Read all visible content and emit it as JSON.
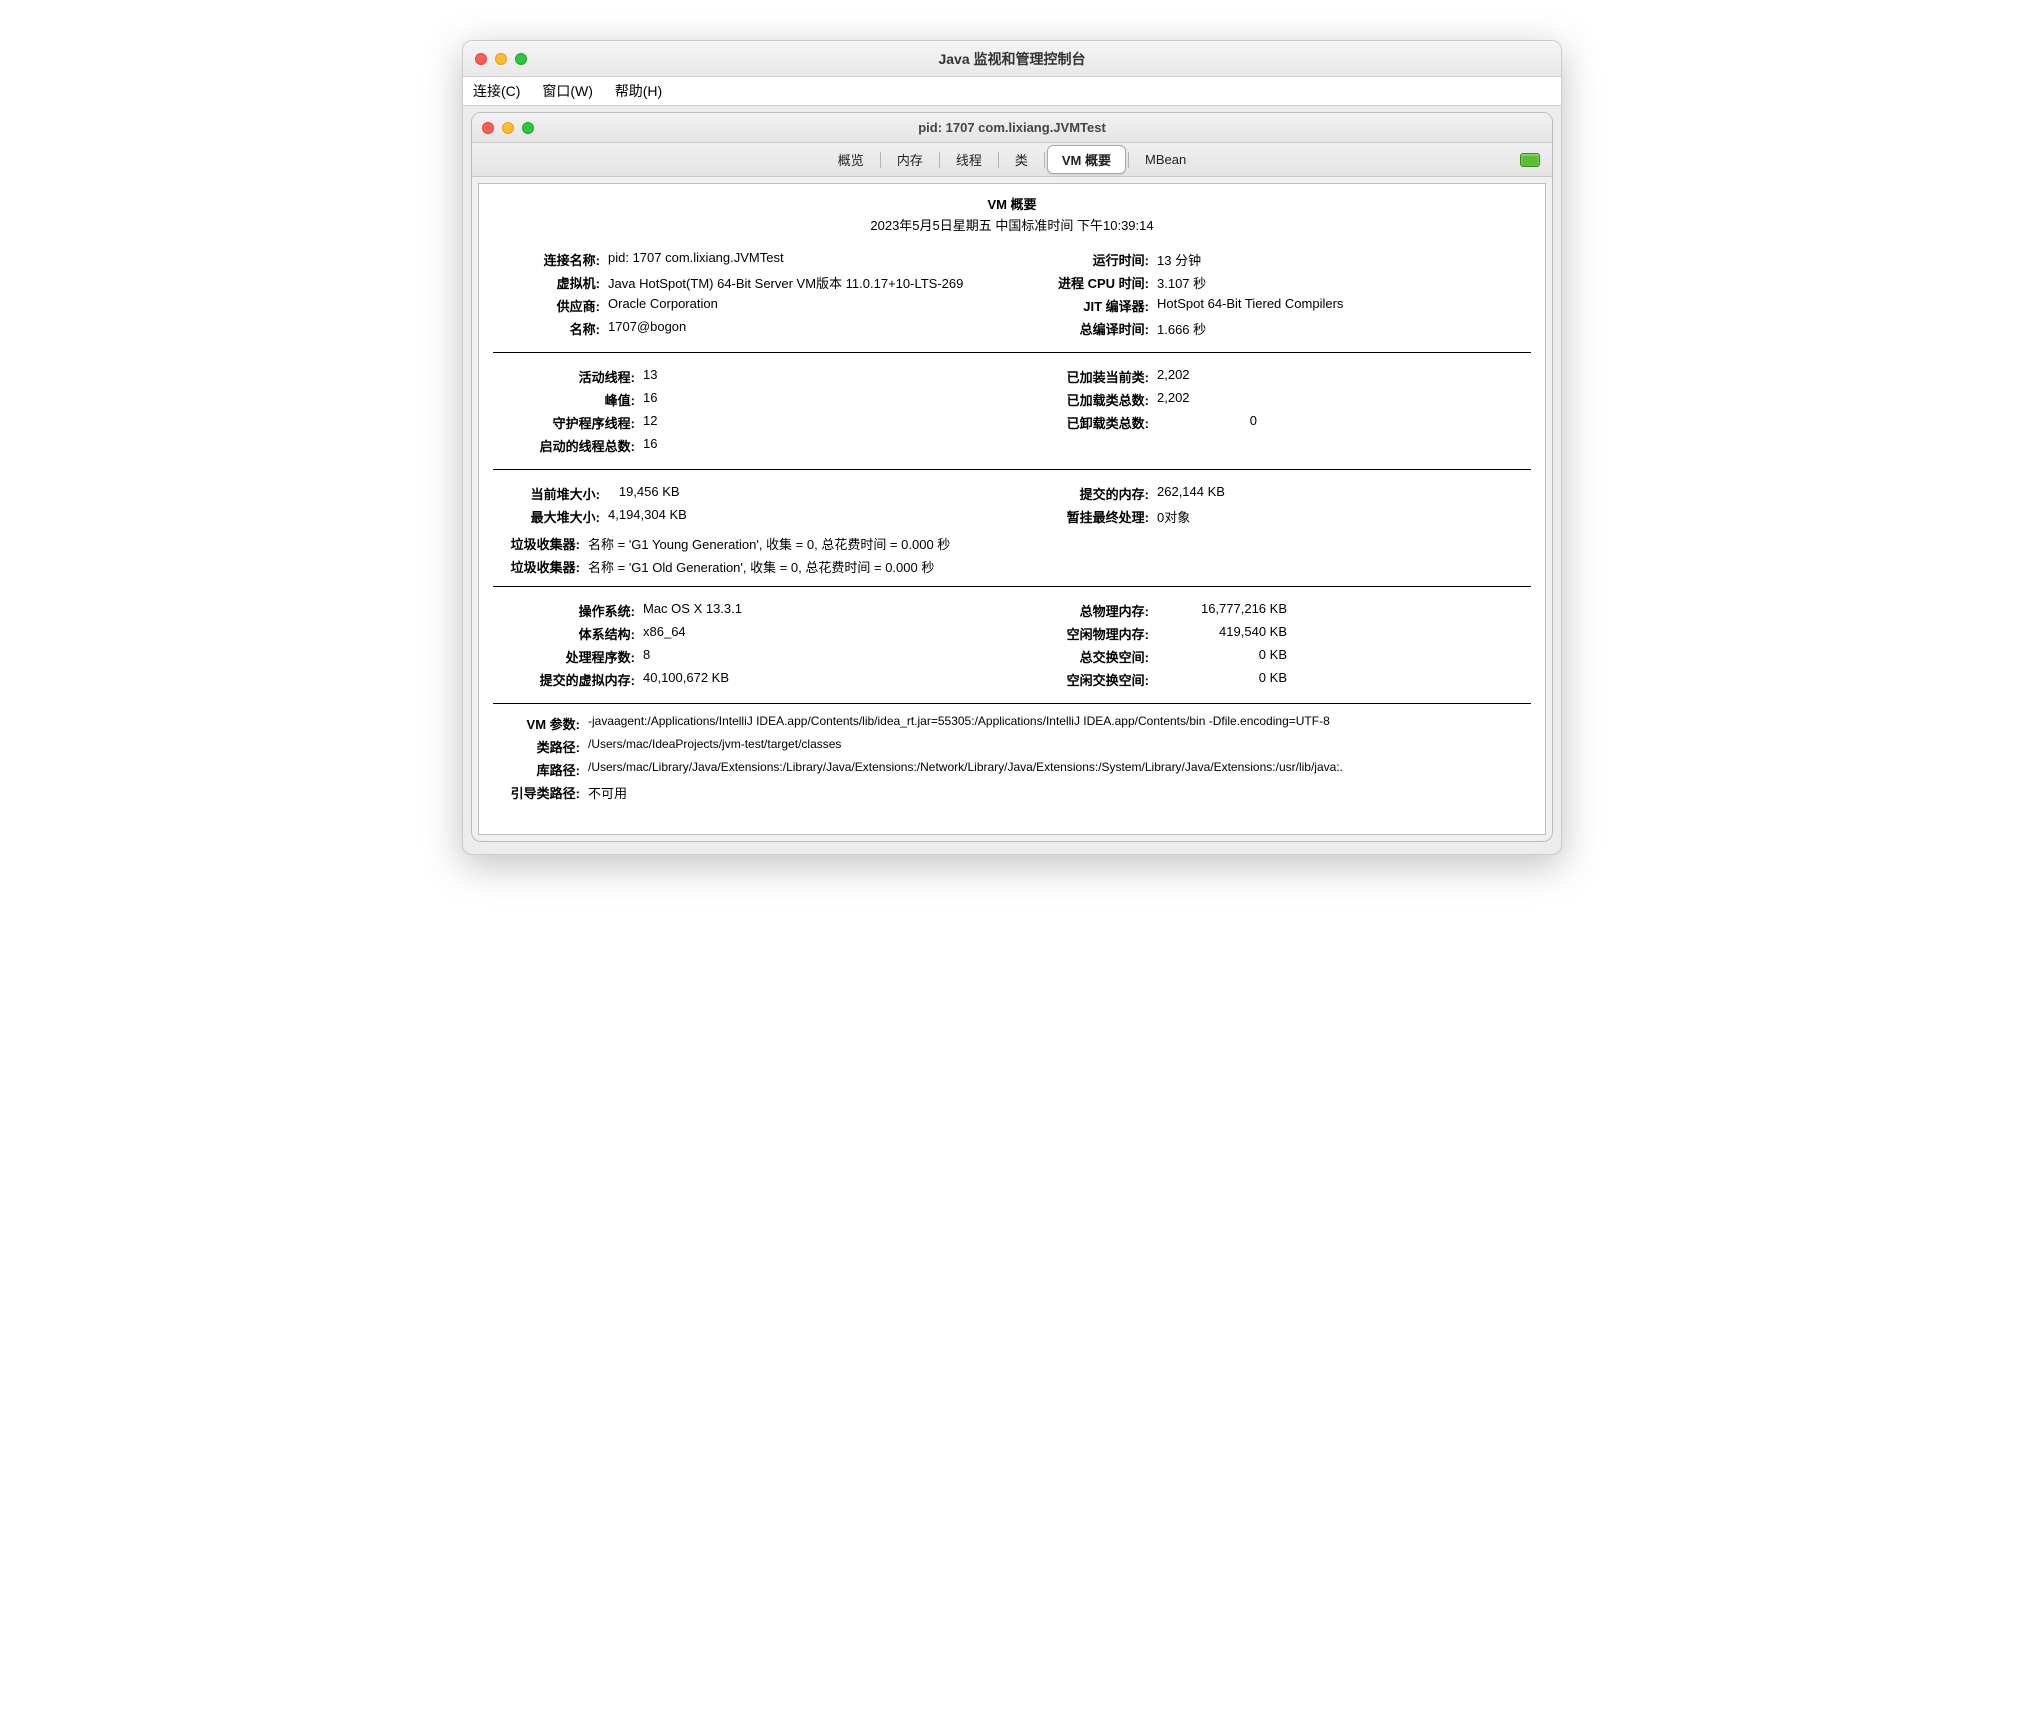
{
  "outer": {
    "title": "Java 监视和管理控制台",
    "menu": {
      "connect": "连接(C)",
      "window": "窗口(W)",
      "help": "帮助(H)"
    }
  },
  "inner": {
    "title": "pid: 1707 com.lixiang.JVMTest",
    "tabs": {
      "overview": "概览",
      "memory": "内存",
      "threads": "线程",
      "classes": "类",
      "vm": "VM 概要",
      "mbean": "MBean"
    }
  },
  "vm": {
    "heading": "VM 概要",
    "date": "2023年5月5日星期五 中国标准时间 下午10:39:14"
  },
  "labels": {
    "connName": "连接名称:",
    "vm": "虚拟机:",
    "vendor": "供应商:",
    "name": "名称:",
    "uptime": "运行时间:",
    "cpuTime": "进程 CPU 时间:",
    "jit": "JIT 编译器:",
    "compileTime": "总编译时间:",
    "liveThreads": "活动线程:",
    "peak": "峰值:",
    "daemon": "守护程序线程:",
    "totalStarted": "启动的线程总数:",
    "loadedCur": "已加装当前类:",
    "loadedTot": "已加载类总数:",
    "unloaded": "已卸载类总数:",
    "heapCur": "当前堆大小:",
    "heapMax": "最大堆大小:",
    "committed": "提交的内存:",
    "pending": "暂挂最终处理:",
    "gc": "垃圾收集器:",
    "os": "操作系统:",
    "arch": "体系结构:",
    "procs": "处理程序数:",
    "vmem": "提交的虚拟内存:",
    "phyTot": "总物理内存:",
    "phyFree": "空闲物理内存:",
    "swapTot": "总交换空间:",
    "swapFree": "空闲交换空间:",
    "vmArgs": "VM 参数:",
    "classpath": "类路径:",
    "libpath": "库路径:",
    "bootcp": "引导类路径:"
  },
  "values": {
    "connName": "pid: 1707 com.lixiang.JVMTest",
    "vm": "Java HotSpot(TM) 64-Bit Server VM版本 11.0.17+10-LTS-269",
    "vendor": "Oracle Corporation",
    "name": "1707@bogon",
    "uptime": "13 分钟",
    "cpuTime": "3.107 秒",
    "jit": "HotSpot 64-Bit Tiered Compilers",
    "compileTime": "1.666 秒",
    "liveThreads": "13",
    "peak": "16",
    "daemon": "12",
    "totalStarted": "16",
    "loadedCur": "2,202",
    "loadedTot": "2,202",
    "unloaded": "0",
    "heapCur": "   19,456 KB",
    "heapMax": "4,194,304 KB",
    "committed": "262,144 KB",
    "pending": "0对象",
    "gc1": "名称 = 'G1 Young Generation', 收集 = 0, 总花费时间 = 0.000 秒",
    "gc2": "名称 = 'G1 Old Generation', 收集 = 0, 总花费时间 = 0.000 秒",
    "os": "Mac OS X 13.3.1",
    "arch": "x86_64",
    "procs": "8",
    "vmem": "40,100,672 KB",
    "phyTot": "16,777,216 KB",
    "phyFree": "   419,540 KB",
    "swapTot": "         0 KB",
    "swapFree": "         0 KB",
    "vmArgs": "-javaagent:/Applications/IntelliJ IDEA.app/Contents/lib/idea_rt.jar=55305:/Applications/IntelliJ IDEA.app/Contents/bin -Dfile.encoding=UTF-8",
    "classpath": "/Users/mac/IdeaProjects/jvm-test/target/classes",
    "libpath": "/Users/mac/Library/Java/Extensions:/Library/Java/Extensions:/Network/Library/Java/Extensions:/System/Library/Java/Extensions:/usr/lib/java:.",
    "bootcp": "不可用"
  }
}
